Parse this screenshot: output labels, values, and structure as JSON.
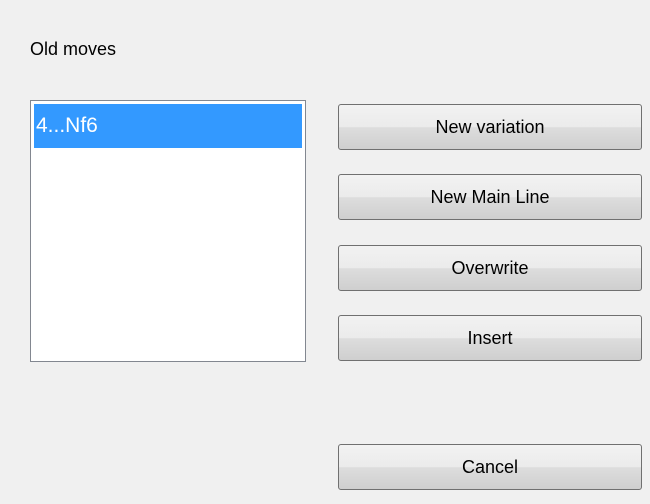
{
  "dialog": {
    "group_label": "Old moves",
    "moves": [
      "4...Nf6"
    ],
    "buttons": {
      "new_variation": "New variation",
      "new_main_line": "New Main Line",
      "overwrite": "Overwrite",
      "insert": "Insert",
      "cancel": "Cancel"
    }
  },
  "colors": {
    "selection": "#3399ff",
    "dialog_background": "#f0f0f0"
  }
}
